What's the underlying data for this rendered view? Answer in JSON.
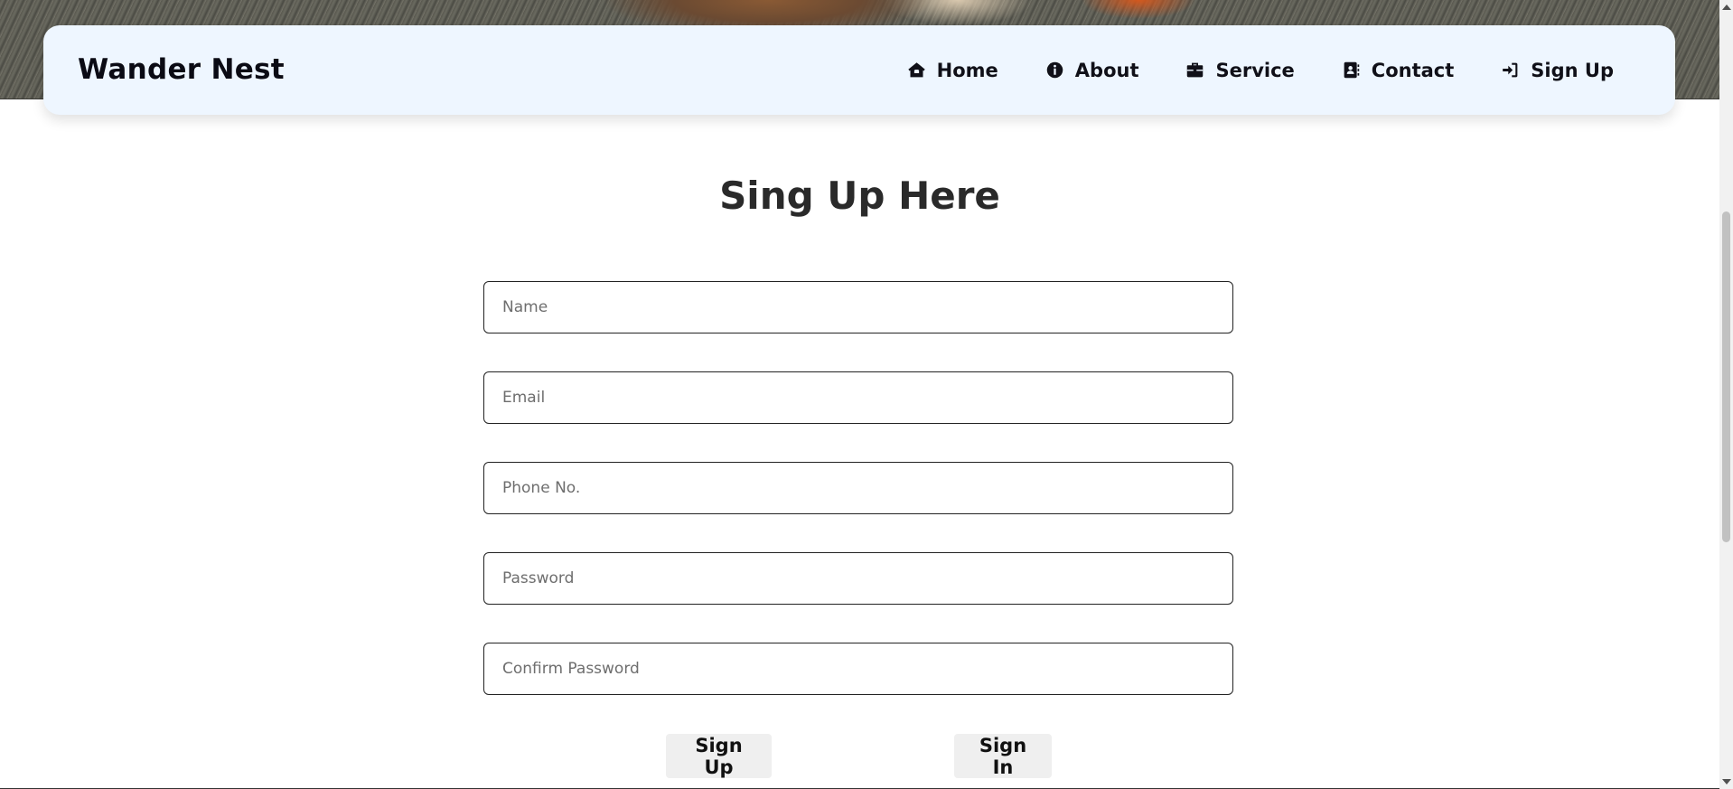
{
  "header": {
    "brand": "Wander Nest",
    "nav": [
      {
        "label": "Home",
        "icon": "house-icon"
      },
      {
        "label": "About",
        "icon": "info-circle-icon"
      },
      {
        "label": "Service",
        "icon": "briefcase-icon"
      },
      {
        "label": "Contact",
        "icon": "address-book-icon"
      },
      {
        "label": "Sign Up",
        "icon": "sign-in-icon"
      }
    ]
  },
  "form": {
    "title": "Sing Up Here",
    "fields": {
      "name": {
        "placeholder": "Name",
        "value": ""
      },
      "email": {
        "placeholder": "Email",
        "value": ""
      },
      "phone": {
        "placeholder": "Phone No.",
        "value": ""
      },
      "password": {
        "placeholder": "Password",
        "value": ""
      },
      "confirm_password": {
        "placeholder": "Confirm Password",
        "value": ""
      }
    },
    "buttons": {
      "sign_up": "Sign Up",
      "sign_in": "Sign In"
    }
  },
  "colors": {
    "navbar_bg": "#eef6ff",
    "text_dark": "#101018",
    "button_bg": "#efefef"
  }
}
